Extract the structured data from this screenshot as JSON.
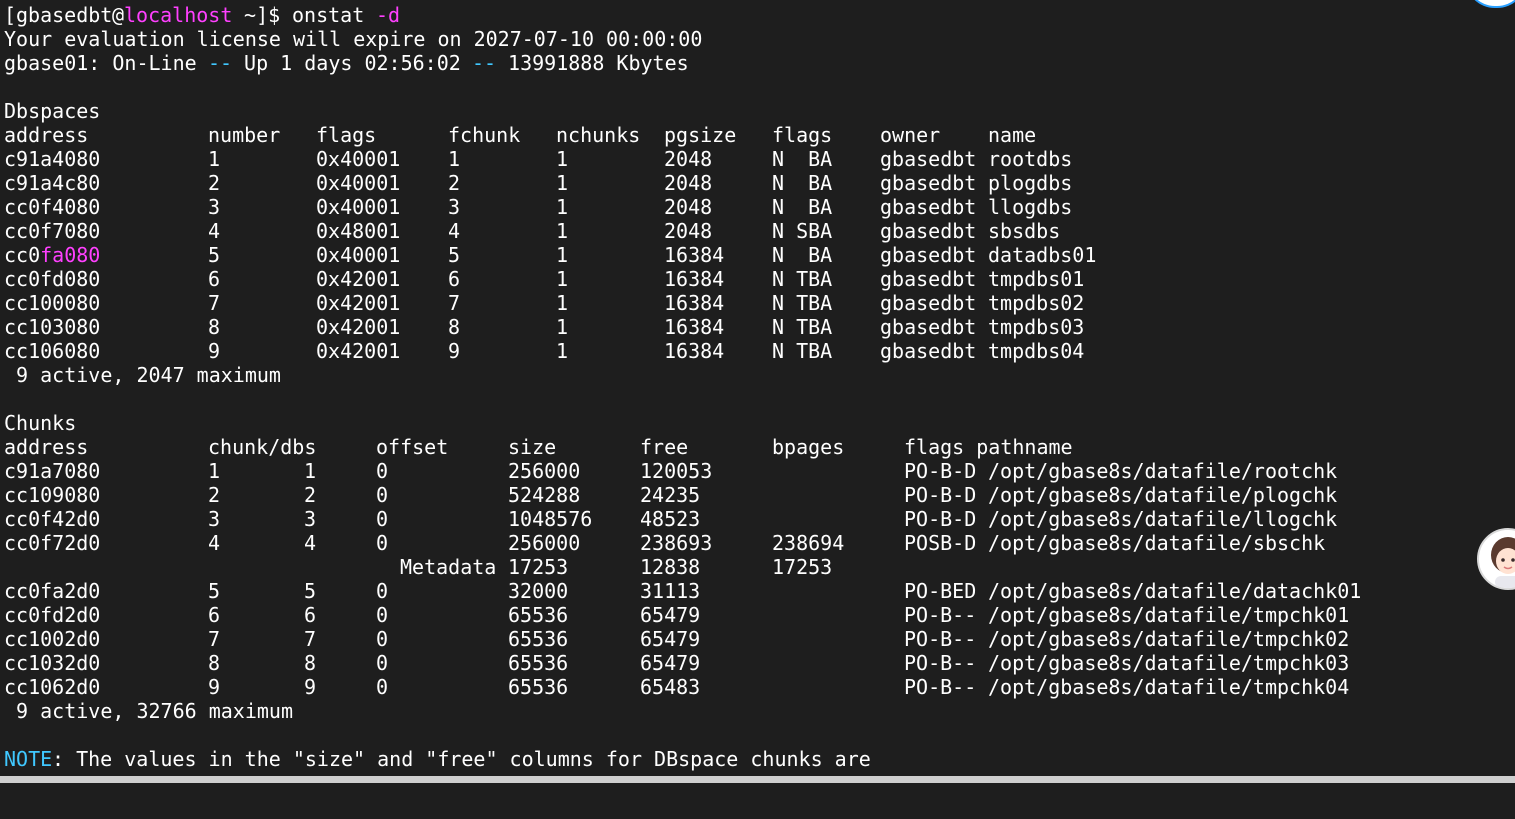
{
  "prompt": {
    "user": "gbasedbt",
    "at": "@",
    "host": "localhost",
    "path": " ~]$ ",
    "open": "[",
    "command": "onstat",
    "arg": "-d"
  },
  "license_line": "Your evaluation license will expire on 2027-07-10 00:00:00",
  "status": {
    "server": "gbase01: On-Line ",
    "sep1": "--",
    "uptime": " Up 1 days 02:56:02 ",
    "sep2": "--",
    "memory": " 13991888 Kbytes"
  },
  "dbspaces": {
    "title": "Dbspaces",
    "headers": [
      "address",
      "number",
      "flags",
      "fchunk",
      "nchunks",
      "pgsize",
      "flags",
      "owner",
      "name"
    ],
    "rows": [
      [
        "c91a4080",
        "1",
        "0x40001",
        "1",
        "1",
        "2048",
        "N  BA",
        "gbasedbt",
        "rootdbs"
      ],
      [
        "c91a4c80",
        "2",
        "0x40001",
        "2",
        "1",
        "2048",
        "N  BA",
        "gbasedbt",
        "plogdbs"
      ],
      [
        "cc0f4080",
        "3",
        "0x40001",
        "3",
        "1",
        "2048",
        "N  BA",
        "gbasedbt",
        "llogdbs"
      ],
      [
        "cc0f7080",
        "4",
        "0x48001",
        "4",
        "1",
        "2048",
        "N SBA",
        "gbasedbt",
        "sbsdbs"
      ],
      [
        "cc0fa080",
        "5",
        "0x40001",
        "5",
        "1",
        "16384",
        "N  BA",
        "gbasedbt",
        "datadbs01"
      ],
      [
        "cc0fd080",
        "6",
        "0x42001",
        "6",
        "1",
        "16384",
        "N TBA",
        "gbasedbt",
        "tmpdbs01"
      ],
      [
        "cc100080",
        "7",
        "0x42001",
        "7",
        "1",
        "16384",
        "N TBA",
        "gbasedbt",
        "tmpdbs02"
      ],
      [
        "cc103080",
        "8",
        "0x42001",
        "8",
        "1",
        "16384",
        "N TBA",
        "gbasedbt",
        "tmpdbs03"
      ],
      [
        "cc106080",
        "9",
        "0x42001",
        "9",
        "1",
        "16384",
        "N TBA",
        "gbasedbt",
        "tmpdbs04"
      ]
    ],
    "highlight": {
      "row": 4,
      "prefix": "cc0",
      "colored": "fa080"
    },
    "summary": " 9 active, 2047 maximum"
  },
  "chunks": {
    "title": "Chunks",
    "headers": [
      "address",
      "chunk/dbs",
      "offset",
      "size",
      "free",
      "bpages",
      "flags pathname"
    ],
    "rows": [
      {
        "address": "c91a7080",
        "chunk": "1",
        "dbs": "1",
        "offset": "0",
        "size": "256000",
        "free": "120053",
        "bpages": "",
        "flags": "PO-B-D",
        "path": "/opt/gbase8s/datafile/rootchk"
      },
      {
        "address": "cc109080",
        "chunk": "2",
        "dbs": "2",
        "offset": "0",
        "size": "524288",
        "free": "24235",
        "bpages": "",
        "flags": "PO-B-D",
        "path": "/opt/gbase8s/datafile/plogchk"
      },
      {
        "address": "cc0f42d0",
        "chunk": "3",
        "dbs": "3",
        "offset": "0",
        "size": "1048576",
        "free": "48523",
        "bpages": "",
        "flags": "PO-B-D",
        "path": "/opt/gbase8s/datafile/llogchk"
      },
      {
        "address": "cc0f72d0",
        "chunk": "4",
        "dbs": "4",
        "offset": "0",
        "size": "256000",
        "free": "238693",
        "bpages": "238694",
        "flags": "POSB-D",
        "path": "/opt/gbase8s/datafile/sbschk"
      },
      {
        "address": "cc0fa2d0",
        "chunk": "5",
        "dbs": "5",
        "offset": "0",
        "size": "32000",
        "free": "31113",
        "bpages": "",
        "flags": "PO-BED",
        "path": "/opt/gbase8s/datafile/datachk01"
      },
      {
        "address": "cc0fd2d0",
        "chunk": "6",
        "dbs": "6",
        "offset": "0",
        "size": "65536",
        "free": "65479",
        "bpages": "",
        "flags": "PO-B--",
        "path": "/opt/gbase8s/datafile/tmpchk01"
      },
      {
        "address": "cc1002d0",
        "chunk": "7",
        "dbs": "7",
        "offset": "0",
        "size": "65536",
        "free": "65479",
        "bpages": "",
        "flags": "PO-B--",
        "path": "/opt/gbase8s/datafile/tmpchk02"
      },
      {
        "address": "cc1032d0",
        "chunk": "8",
        "dbs": "8",
        "offset": "0",
        "size": "65536",
        "free": "65479",
        "bpages": "",
        "flags": "PO-B--",
        "path": "/opt/gbase8s/datafile/tmpchk03"
      },
      {
        "address": "cc1062d0",
        "chunk": "9",
        "dbs": "9",
        "offset": "0",
        "size": "65536",
        "free": "65483",
        "bpages": "",
        "flags": "PO-B--",
        "path": "/opt/gbase8s/datafile/tmpchk04"
      }
    ],
    "metadata": {
      "label": "Metadata",
      "size": "17253",
      "free": "12838",
      "bpages": "17253"
    },
    "summary": " 9 active, 32766 maximum"
  },
  "note": {
    "label": "NOTE",
    "text": ": The values in the \"size\" and \"free\" columns for DBspace chunks are"
  },
  "colors": {
    "background": "#1e1e1e",
    "text": "#ffffff",
    "host_highlight": "#ff40ff",
    "note_and_separators": "#40c8ff"
  }
}
